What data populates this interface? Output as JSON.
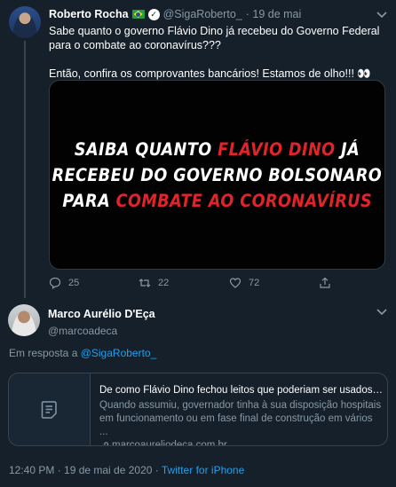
{
  "tweet1": {
    "name": "Roberto Rocha",
    "handle": "@SigaRoberto_",
    "date": "· 19 de mai",
    "text_line1": "Sabe quanto o governo Flávio Dino já recebeu do Governo Federal para o combate ao coronavírus???",
    "text_line2": "Então, confira os comprovantes bancários! Estamos de olho!!! 👀",
    "media": {
      "line1_white": "SAIBA QUANTO ",
      "line1_red": "FLÁVIO DINO",
      "line1_white_end": " JÁ",
      "line2": "RECEBEU DO GOVERNO BOLSONARO",
      "line3_white": "PARA ",
      "line3_red": "COMBATE AO CORONAVÍRUS"
    },
    "replies": "25",
    "retweets": "22",
    "likes": "72"
  },
  "tweet2": {
    "name": "Marco Aurélio D'Eça",
    "handle": "@marcoadeca",
    "reply_prefix": "Em resposta a ",
    "reply_to": "@SigaRoberto_",
    "card": {
      "title": "De como Flávio Dino fechou leitos que poderiam ser usados c...",
      "description": "Quando assumiu, governador tinha à sua disposição hospitais em funcionamento ou em fase final de construção em vários ...",
      "domain": "marcoaureliodeca.com.br"
    },
    "timestamp": "12:40 PM · 19 de mai de 2020 · ",
    "source": "Twitter for iPhone"
  },
  "colors": {
    "background": "#15202b",
    "accent": "#1da1f2",
    "muted": "#8899a6",
    "red_text": "#e0242a"
  }
}
